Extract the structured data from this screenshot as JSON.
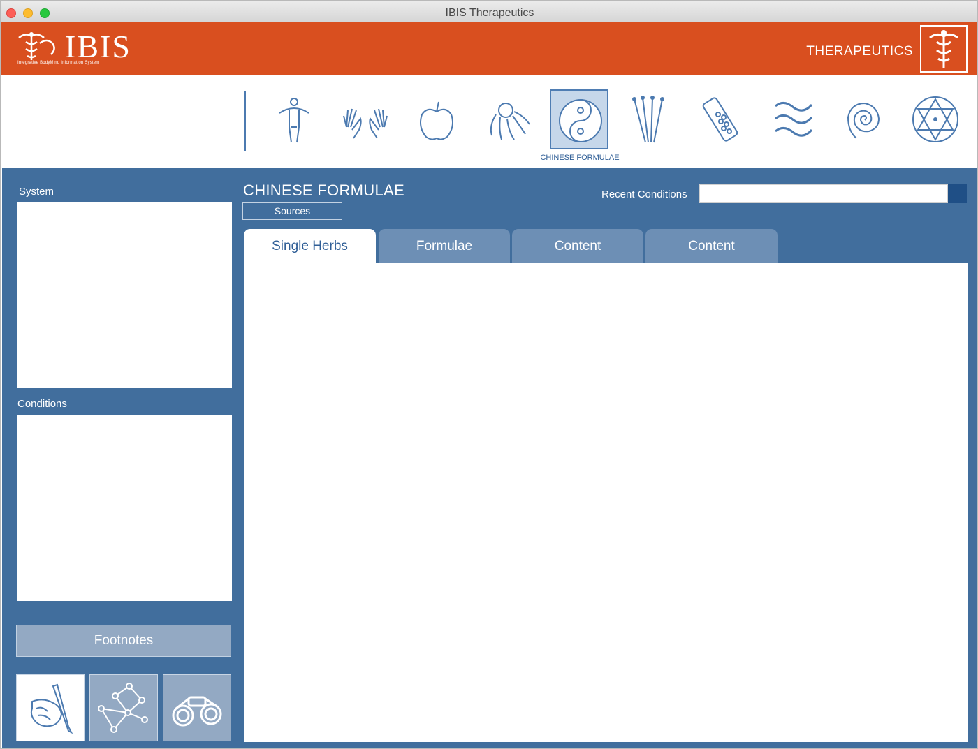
{
  "window": {
    "title": "IBIS Therapeutics"
  },
  "header": {
    "logo_text": "IBIS",
    "logo_subtitle": "Integrative BodyMind Information System",
    "brand_label": "THERAPEUTICS",
    "color": "#d94f1f"
  },
  "toolbar": {
    "icons": [
      {
        "name": "body-figure-icon"
      },
      {
        "name": "hands-icon"
      },
      {
        "name": "apple-icon"
      },
      {
        "name": "flower-icon"
      },
      {
        "name": "yin-yang-icon",
        "active": true
      },
      {
        "name": "acupuncture-needles-icon"
      },
      {
        "name": "homeopathy-vial-icon"
      },
      {
        "name": "waves-icon"
      },
      {
        "name": "spiral-icon"
      },
      {
        "name": "star-circle-icon"
      }
    ],
    "active_label": "CHINESE FORMULAE"
  },
  "sidebar": {
    "system_label": "System",
    "conditions_label": "Conditions",
    "footnotes_label": "Footnotes",
    "tools": [
      "pen-hand-icon",
      "network-icon",
      "binoculars-icon"
    ]
  },
  "main": {
    "title": "CHINESE FORMULAE",
    "sources_label": "Sources",
    "recent_label": "Recent Conditions",
    "recent_value": "",
    "tabs": [
      {
        "label": "Single Herbs",
        "active": true
      },
      {
        "label": "Formulae"
      },
      {
        "label": "Content"
      },
      {
        "label": "Content"
      }
    ]
  },
  "colors": {
    "panel": "#416e9d",
    "tab": "#6d8fb5",
    "accent_text": "#2f5e96"
  }
}
